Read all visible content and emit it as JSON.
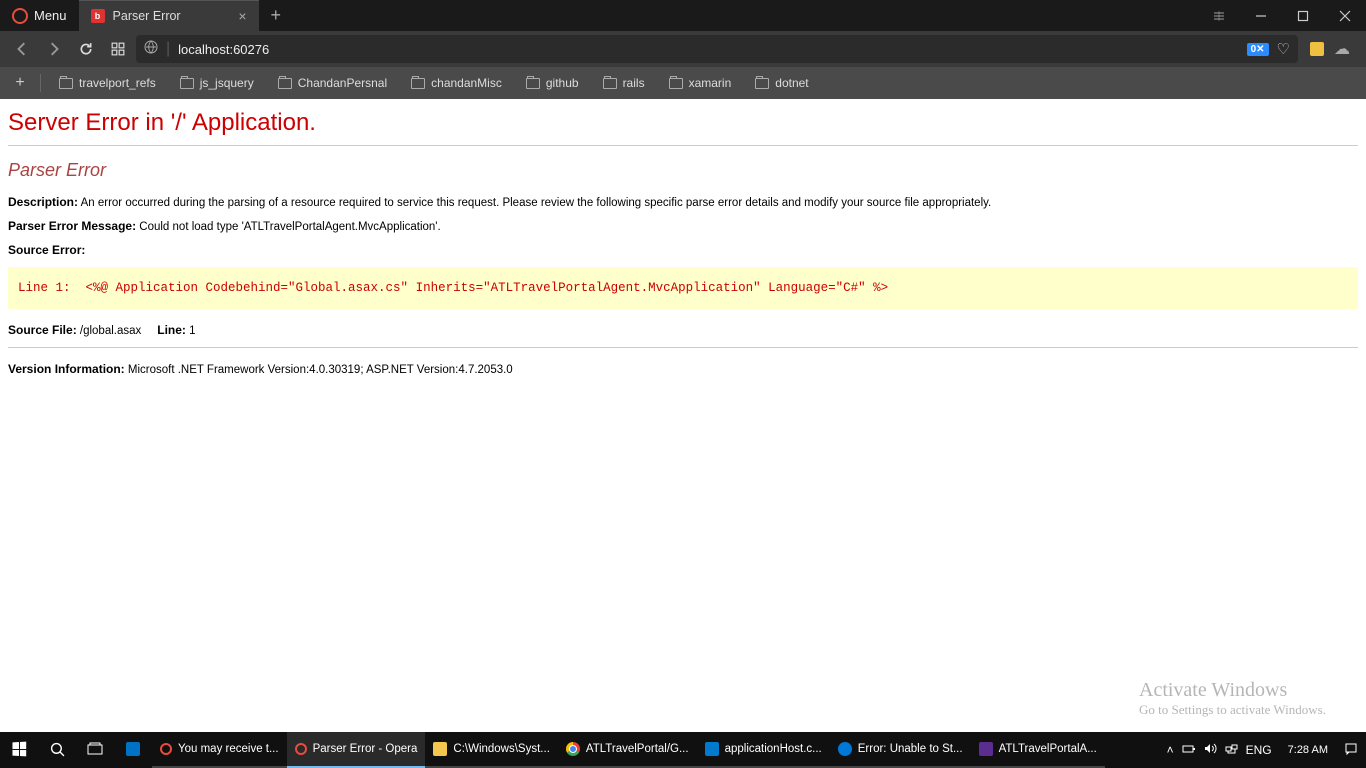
{
  "browser": {
    "menu_label": "Menu",
    "tab_title": "Parser Error",
    "address": "localhost:60276",
    "address_badge": "0",
    "bookmarks": [
      "travelport_refs",
      "js_jsquery",
      "ChandanPersnal",
      "chandanMisc",
      "github",
      "rails",
      "xamarin",
      "dotnet"
    ]
  },
  "error": {
    "h1": "Server Error in '/' Application.",
    "h2": "Parser Error",
    "desc_label": "Description:",
    "desc_text": "An error occurred during the parsing of a resource required to service this request. Please review the following specific parse error details and modify your source file appropriately.",
    "msg_label": "Parser Error Message:",
    "msg_text": "Could not load type 'ATLTravelPortalAgent.MvcApplication'.",
    "src_label": "Source Error:",
    "src_code": "Line 1:  <%@ Application Codebehind=\"Global.asax.cs\" Inherits=\"ATLTravelPortalAgent.MvcApplication\" Language=\"C#\" %>",
    "file_label": "Source File:",
    "file_text": "/global.asax",
    "line_label": "Line:",
    "line_num": "1",
    "ver_label": "Version Information:",
    "ver_text": "Microsoft .NET Framework Version:4.0.30319; ASP.NET Version:4.7.2053.0"
  },
  "watermark": {
    "title": "Activate Windows",
    "sub": "Go to Settings to activate Windows."
  },
  "taskbar": {
    "apps": [
      {
        "label": "You may receive t...",
        "ico": "ico-opera"
      },
      {
        "label": "Parser Error - Opera",
        "ico": "ico-opera",
        "active": true
      },
      {
        "label": "C:\\Windows\\Syst...",
        "ico": "ico-folder"
      },
      {
        "label": "ATLTravelPortal/G...",
        "ico": "ico-chrome"
      },
      {
        "label": "applicationHost.c...",
        "ico": "ico-vscode"
      },
      {
        "label": "Error: Unable to St...",
        "ico": "ico-edge"
      },
      {
        "label": "ATLTravelPortalA...",
        "ico": "ico-vs"
      }
    ],
    "lang": "ENG",
    "time": "7:28 AM"
  }
}
